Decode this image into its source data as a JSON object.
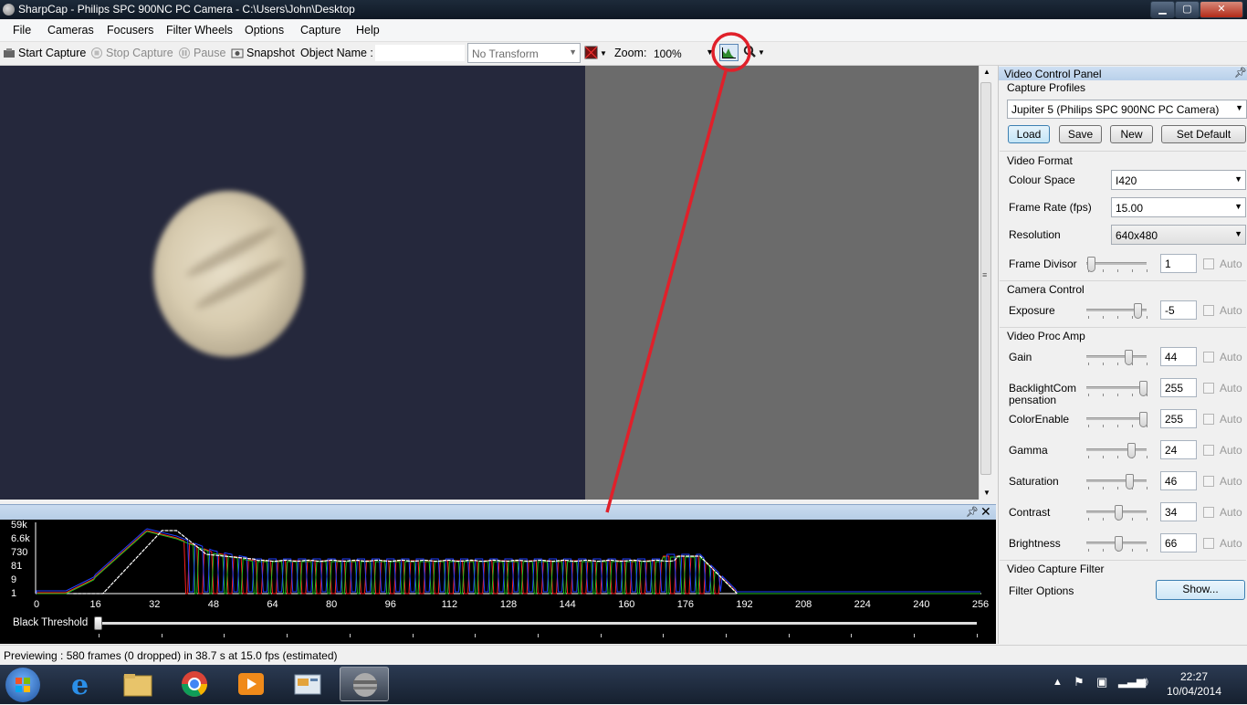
{
  "window": {
    "title": "SharpCap - Philips SPC 900NC PC Camera - C:\\Users\\John\\Desktop",
    "minimize": "▁",
    "maximize": "▢",
    "close": "✕"
  },
  "menu": [
    "File",
    "Cameras",
    "Focusers",
    "Filter Wheels",
    "Options",
    "Capture",
    "Help"
  ],
  "toolbar": {
    "start_capture": "Start Capture",
    "stop_capture": "Stop Capture",
    "pause": "Pause",
    "snapshot": "Snapshot",
    "object_name_label": "Object Name :",
    "object_name_value": "",
    "transform": "No Transform",
    "zoom_label": "Zoom:",
    "zoom_value": "100%"
  },
  "histogram": {
    "y_labels": [
      "59k",
      "6.6k",
      "730",
      "81",
      "9",
      "1"
    ],
    "x_labels": [
      "0",
      "16",
      "32",
      "48",
      "64",
      "80",
      "96",
      "112",
      "128",
      "144",
      "160",
      "176",
      "192",
      "208",
      "224",
      "240",
      "256"
    ],
    "black_threshold_label": "Black Threshold",
    "black_threshold_value": 0,
    "colors": {
      "red": "#ff2020",
      "green": "#20c020",
      "blue": "#2040ff",
      "white": "#ffffff"
    }
  },
  "panel": {
    "title": "Video Control Panel",
    "capture_profiles": {
      "heading": "Capture Profiles",
      "selected": "Jupiter 5 (Philips SPC 900NC PC Camera)",
      "buttons": [
        "Load",
        "Save",
        "New",
        "Set Default"
      ]
    },
    "video_format": {
      "heading": "Video Format",
      "colour_space": {
        "label": "Colour Space",
        "value": "I420"
      },
      "frame_rate": {
        "label": "Frame Rate (fps)",
        "value": "15.00"
      },
      "resolution": {
        "label": "Resolution",
        "value": "640x480"
      },
      "frame_divisor": {
        "label": "Frame Divisor",
        "value": "1",
        "auto": "Auto"
      }
    },
    "camera_control": {
      "heading": "Camera Control",
      "exposure": {
        "label": "Exposure",
        "value": "-5",
        "auto": "Auto"
      }
    },
    "video_proc_amp": {
      "heading": "Video Proc Amp",
      "gain": {
        "label": "Gain",
        "value": "44",
        "auto": "Auto"
      },
      "backlight": {
        "label": "BacklightCom\npensation",
        "value": "255",
        "auto": "Auto"
      },
      "colorenable": {
        "label": "ColorEnable",
        "value": "255",
        "auto": "Auto"
      },
      "gamma": {
        "label": "Gamma",
        "value": "24",
        "auto": "Auto"
      },
      "saturation": {
        "label": "Saturation",
        "value": "46",
        "auto": "Auto"
      },
      "contrast": {
        "label": "Contrast",
        "value": "34",
        "auto": "Auto"
      },
      "brightness": {
        "label": "Brightness",
        "value": "66",
        "auto": "Auto"
      }
    },
    "video_capture_filter": {
      "heading": "Video Capture Filter",
      "filter_options": {
        "label": "Filter Options",
        "button": "Show..."
      }
    }
  },
  "status": "Previewing : 580 frames (0 dropped) in 38.7 s at 15.0 fps (estimated)",
  "taskbar": {
    "time": "22:27",
    "date": "10/04/2014"
  },
  "annotation_color": "#e0202a"
}
